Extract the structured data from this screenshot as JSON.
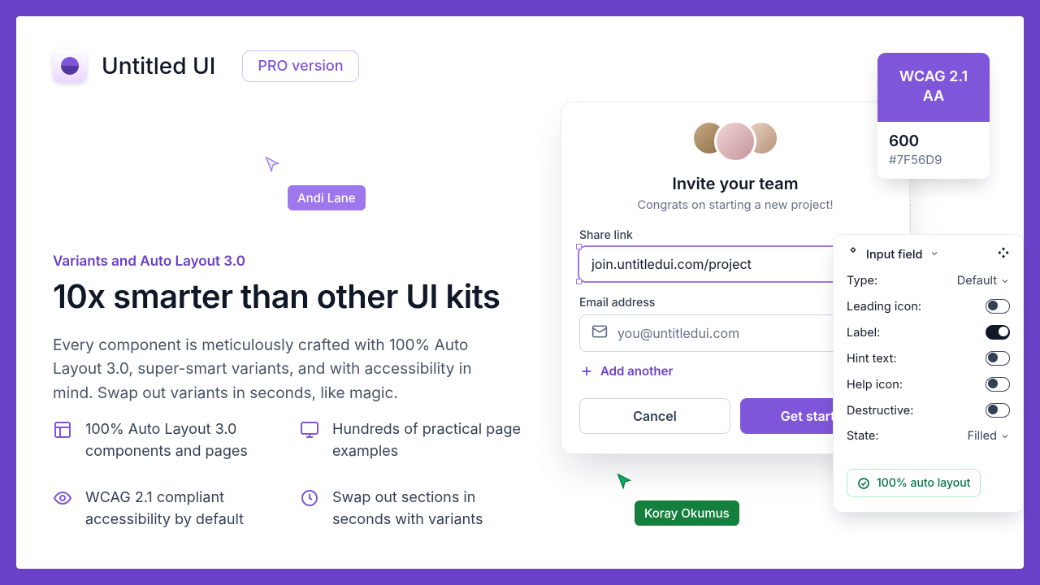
{
  "brand": {
    "name": "Untitled UI",
    "badge": "PRO version"
  },
  "hero": {
    "eyebrow": "Variants and Auto Layout 3.0",
    "headline": "10x smarter than other UI kits",
    "body": "Every component is meticulously crafted with 100% Auto Layout 3.0, super-smart variants, and with accessibility in mind. Swap out variants in seconds, like magic."
  },
  "features": [
    {
      "text": "100% Auto Layout 3.0 components and pages",
      "icon": "layout-icon"
    },
    {
      "text": "Hundreds of practical page examples",
      "icon": "monitor-icon"
    },
    {
      "text": "WCAG 2.1 compliant accessibility by default",
      "icon": "eye-icon"
    },
    {
      "text": "Swap out sections in seconds with variants",
      "icon": "clock-icon"
    }
  ],
  "cursors": {
    "andi": "Andi Lane",
    "koray": "Koray Okumus"
  },
  "modal": {
    "title": "Invite your team",
    "subtitle": "Congrats on starting a new project!",
    "share_label": "Share link",
    "share_value": "join.untitledui.com/project",
    "email_label": "Email address",
    "email_placeholder": "you@untitledui.com",
    "add_another": "Add another",
    "cancel": "Cancel",
    "start": "Get started"
  },
  "wcag": {
    "title_line1": "WCAG 2.1",
    "title_line2": "AA",
    "weight": "600",
    "hex": "#7F56D9"
  },
  "panel": {
    "title": "Input field",
    "props": {
      "type": {
        "label": "Type:",
        "value": "Default"
      },
      "leading": {
        "label": "Leading icon:",
        "on": false
      },
      "label": {
        "label": "Label:",
        "on": true
      },
      "hint": {
        "label": "Hint text:",
        "on": false
      },
      "help": {
        "label": "Help icon:",
        "on": false
      },
      "destructive": {
        "label": "Destructive:",
        "on": false
      },
      "state": {
        "label": "State:",
        "value": "Filled"
      }
    },
    "badge": "100% auto layout"
  }
}
